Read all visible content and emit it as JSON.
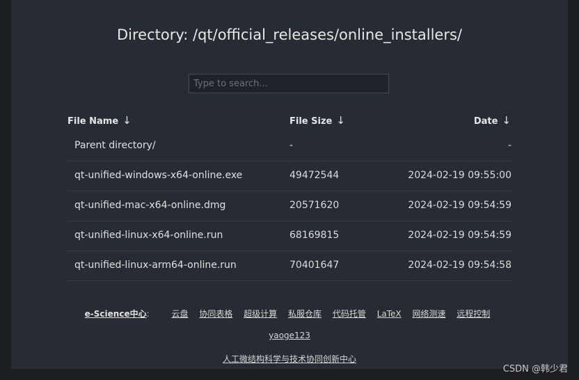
{
  "page": {
    "title": "Directory: /qt/official_releases/online_installers/"
  },
  "search": {
    "placeholder": "Type to search..."
  },
  "table": {
    "headers": {
      "name": "File Name",
      "size": "File Size",
      "date": "Date",
      "sort_arrow": "↓"
    },
    "rows": [
      {
        "name": "Parent directory/",
        "size": "-",
        "date": "-"
      },
      {
        "name": "qt-unified-windows-x64-online.exe",
        "size": "49472544",
        "date": "2024-02-19 09:55:00"
      },
      {
        "name": "qt-unified-mac-x64-online.dmg",
        "size": "20571620",
        "date": "2024-02-19 09:54:59"
      },
      {
        "name": "qt-unified-linux-x64-online.run",
        "size": "68169815",
        "date": "2024-02-19 09:54:59"
      },
      {
        "name": "qt-unified-linux-arm64-online.run",
        "size": "70401647",
        "date": "2024-02-19 09:54:58"
      }
    ]
  },
  "footer": {
    "brand": "e-Science中心",
    "separator": ":",
    "links": [
      "云盘",
      "协同表格",
      "超级计算",
      "私服仓库",
      "代码托管",
      "LaTeX",
      "网络测速",
      "远程控制"
    ],
    "line2": "yaoge123",
    "line3": "人工微结构科学与技术协同创新中心"
  },
  "watermark": {
    "text": "CSDN @韩少君"
  }
}
